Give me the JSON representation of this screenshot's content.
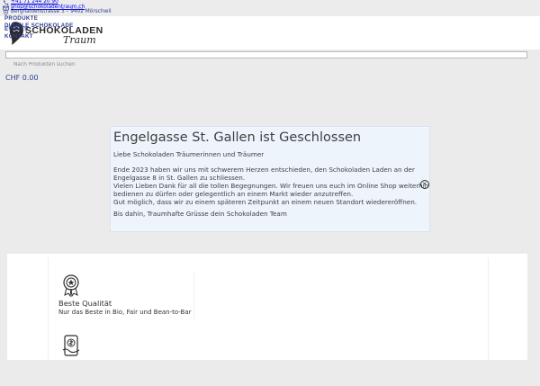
{
  "topbar": {
    "phone": "+41 71 244 20 90",
    "email": "shop@schokoladentraum.ch",
    "address": "Berghaldenstrasse 3 – 9402 Mörschwil"
  },
  "header": {
    "brand": "SCHOKOLADEN",
    "brand_script": "Traum",
    "nav": {
      "products": "PRODUKTE",
      "top_links": "DUNKLE SCHOKOLADE",
      "events": "EVENTS",
      "contact": "KONTAKT"
    }
  },
  "search": {
    "placeholder": "Nach Produkten suchen"
  },
  "cart": {
    "total": "CHF 0.00"
  },
  "modal": {
    "title": "Engelgasse St. Gallen ist Geschlossen",
    "subtitle": "Liebe Schokoladen Träumerinnen und Träumer",
    "paragraph_lines": [
      "Ende 2023 haben wir uns mit schwerem Herzen entschieden, den Schokoladen Laden an der",
      "Engelgasse 8 in St. Gallen zu schliessen.",
      "Vielen Lieben Dank für all die tollen Begegnungen. Wir freuen uns euch im Online Shop weiterhin",
      "bedienen zu dürfen oder gelegentlich an einem Markt wieder anzutreffen.",
      "Gut möglich, dass wir zu einem späteren Zeitpunkt an einem neuen Standort wiedereröffnen."
    ],
    "closing": "Bis dahin, Traumhafte Grüsse dein Schokoladen Team",
    "close_symbol": "×"
  },
  "features": [
    {
      "icon": "award-icon",
      "title": "Beste Qualität",
      "description": "Nur das Beste in Bio, Fair und Bean-to-Bar"
    },
    {
      "icon": "payment-icon",
      "title": "",
      "description": ""
    }
  ],
  "colors": {
    "brand_blue": "#2d3d8e",
    "modal_bg": "#eef4fb",
    "page_bg": "#ebebeb"
  }
}
